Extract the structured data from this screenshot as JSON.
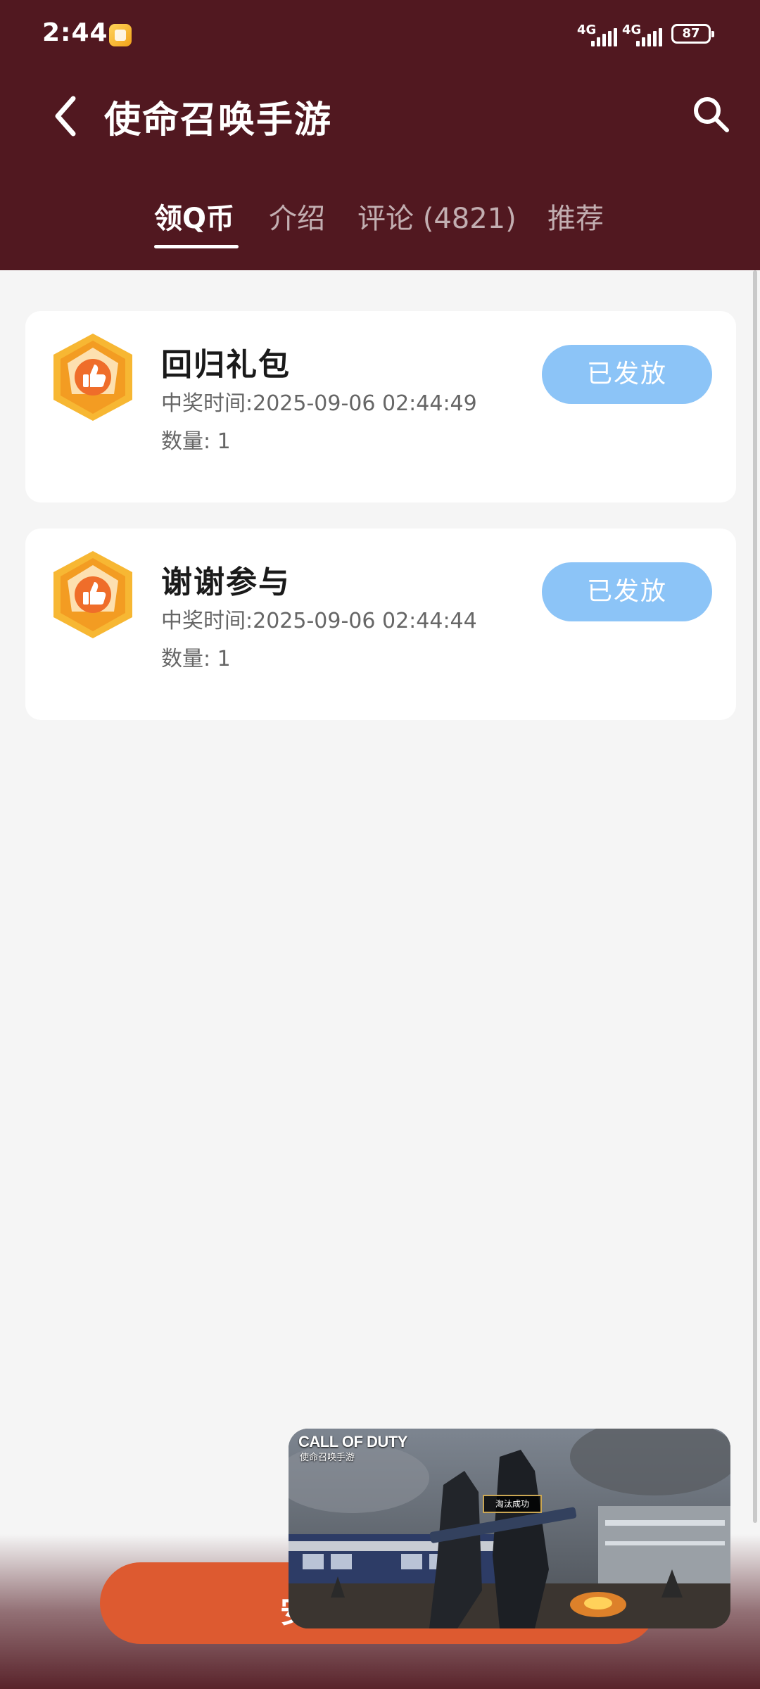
{
  "status_bar": {
    "time": "2:44",
    "network_1": "4G",
    "network_2": "4G",
    "battery": "87"
  },
  "header": {
    "title": "使命召唤手游"
  },
  "tabs": [
    {
      "label": "领Q币",
      "active": true
    },
    {
      "label": "介绍",
      "active": false
    },
    {
      "label": "评论 (4821)",
      "active": false
    },
    {
      "label": "推荐",
      "active": false
    }
  ],
  "rewards": [
    {
      "title": "回归礼包",
      "time": "中奖时间:2025-09-06 02:44:49",
      "quantity": "数量: 1",
      "status": "已发放"
    },
    {
      "title": "谢谢参与",
      "time": "中奖时间:2025-09-06 02:44:44",
      "quantity": "数量: 1",
      "status": "已发放"
    }
  ],
  "floating_video": {
    "logo": "CALL OF DUTY",
    "logo_sub": "使命召唤手游",
    "label": "淘汰成功"
  },
  "primary_action": {
    "label_visible": "安"
  },
  "colors": {
    "header_bg": "#511820",
    "status_button": "#8cc4f7",
    "primary_action": "#dd5a30",
    "badge_orange": "#f5a623"
  }
}
